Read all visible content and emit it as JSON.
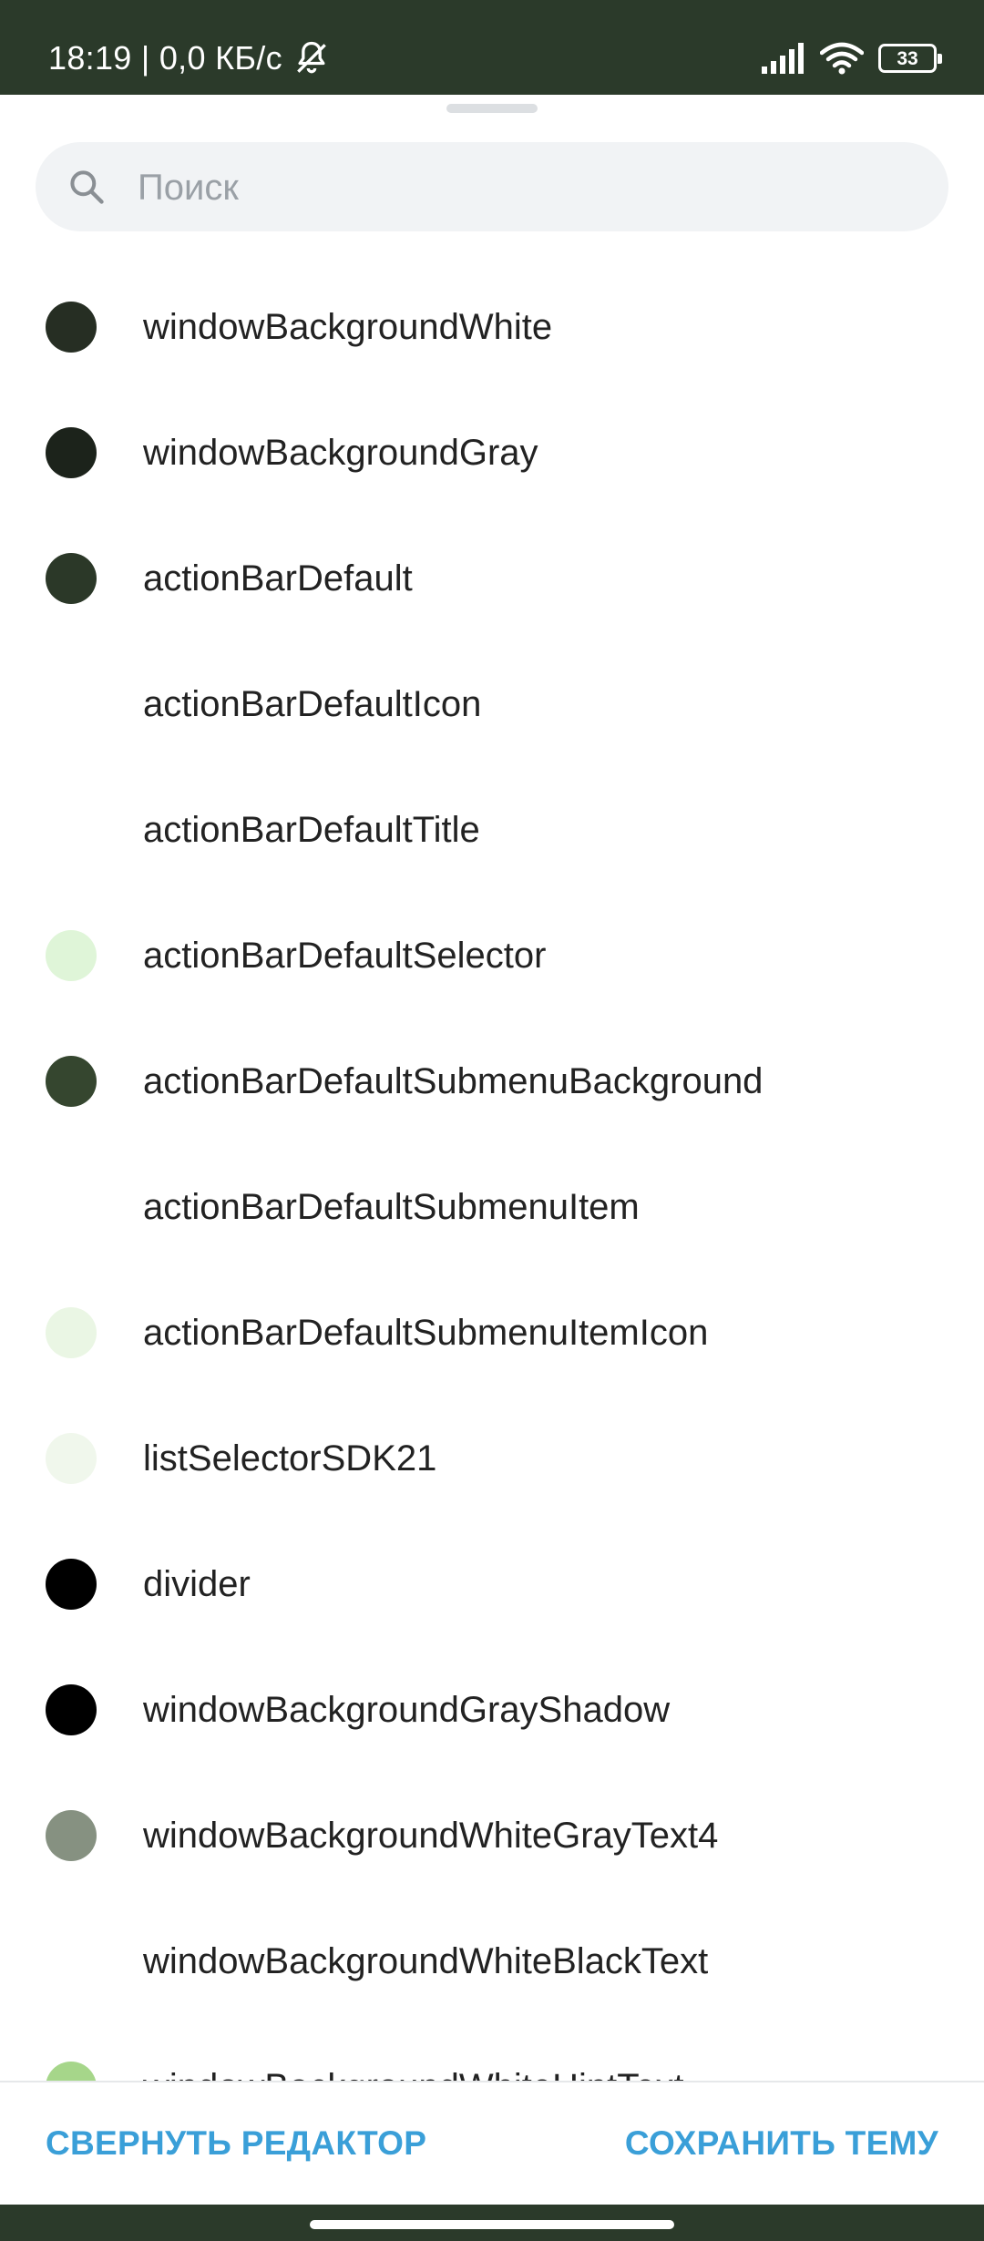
{
  "status_bar": {
    "time_and_speed": "18:19 | 0,0 КБ/с",
    "battery_level": "33"
  },
  "search": {
    "placeholder": "Поиск",
    "value": ""
  },
  "colors": {
    "status_bar_bg": "#2b3a2a",
    "accent": "#3a9fd8"
  },
  "items": [
    {
      "label": "windowBackgroundWhite",
      "color": "#262e23"
    },
    {
      "label": "windowBackgroundGray",
      "color": "#1c231b"
    },
    {
      "label": "actionBarDefault",
      "color": "#2b3828"
    },
    {
      "label": "actionBarDefaultIcon",
      "color": ""
    },
    {
      "label": "actionBarDefaultTitle",
      "color": ""
    },
    {
      "label": "actionBarDefaultSelector",
      "color": "#dff5d8"
    },
    {
      "label": "actionBarDefaultSubmenuBackground",
      "color": "#35462f"
    },
    {
      "label": "actionBarDefaultSubmenuItem",
      "color": ""
    },
    {
      "label": "actionBarDefaultSubmenuItemIcon",
      "color": "#eaf6e4"
    },
    {
      "label": "listSelectorSDK21",
      "color": "#f0f7ec"
    },
    {
      "label": "divider",
      "color": "#000000"
    },
    {
      "label": "windowBackgroundGrayShadow",
      "color": "#000000"
    },
    {
      "label": "windowBackgroundWhiteGrayText4",
      "color": "#869181"
    },
    {
      "label": "windowBackgroundWhiteBlackText",
      "color": ""
    },
    {
      "label": "windowBackgroundWhiteHintText",
      "color": "#a6d68a"
    }
  ],
  "bottom_bar": {
    "collapse_label": "СВЕРНУТЬ РЕДАКТОР",
    "save_label": "СОХРАНИТЬ ТЕМУ"
  }
}
